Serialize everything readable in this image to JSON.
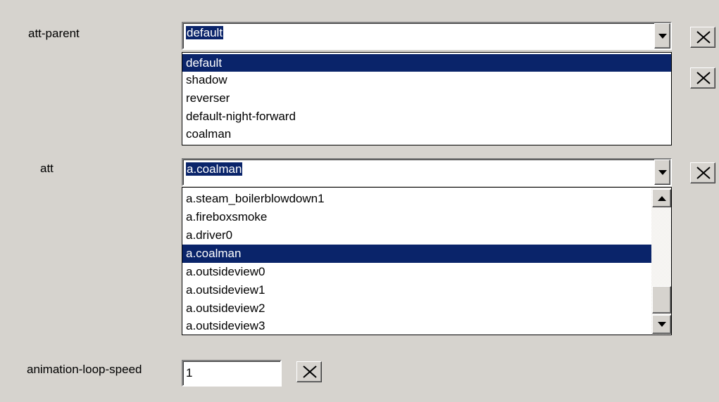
{
  "fields": {
    "att_parent": {
      "label": "att-parent",
      "value": "default",
      "options": [
        "default",
        "shadow",
        "reverser",
        "default-night-forward",
        "coalman"
      ],
      "selected_index": 0
    },
    "att": {
      "label": "att",
      "value": "a.coalman",
      "options": [
        "a.steam_boilerblowdown1",
        "a.fireboxsmoke",
        "a.driver0",
        "a.coalman",
        "a.outsideview0",
        "a.outsideview1",
        "a.outsideview2",
        "a.outsideview3"
      ],
      "selected_index": 3
    },
    "animation_loop_speed": {
      "label": "animation-loop-speed",
      "value": "1"
    }
  },
  "icons": {
    "clear": "close-x-icon",
    "dropdown": "chevron-down-icon",
    "scroll_up": "arrow-up-icon",
    "scroll_down": "arrow-down-icon"
  },
  "colors": {
    "background": "#d6d3ce",
    "selection": "#0a246a",
    "selection_text": "#ffffff"
  }
}
